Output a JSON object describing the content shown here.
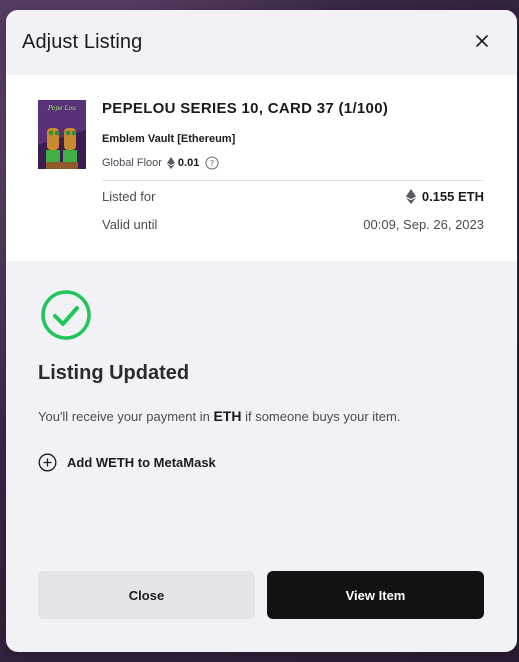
{
  "modal": {
    "title": "Adjust Listing"
  },
  "item": {
    "name": "PEPELOU SERIES 10, CARD 37 (1/100)",
    "collection": "Emblem Vault [Ethereum]",
    "global_floor_label": "Global Floor",
    "global_floor_value": "0.01",
    "thumbnail_caption": "Pepe Lou"
  },
  "listing": {
    "listed_for_label": "Listed for",
    "listed_for_value": "0.155 ETH",
    "valid_until_label": "Valid until",
    "valid_until_value": "00:09, Sep. 26, 2023"
  },
  "status": {
    "heading": "Listing Updated",
    "message_prefix": "You'll receive your payment in",
    "message_token": "ETH",
    "message_suffix": "if someone buys your item.",
    "add_token_label": "Add WETH to MetaMask"
  },
  "buttons": {
    "close": "Close",
    "view_item": "View Item"
  },
  "colors": {
    "success_green": "#21c65a",
    "primary_button": "#111214",
    "secondary_button": "#e4e4e8"
  }
}
